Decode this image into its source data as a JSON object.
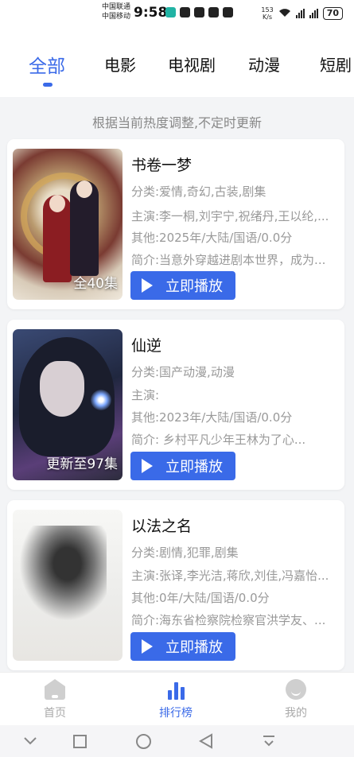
{
  "status_bar": {
    "carrier_1": "中国联通",
    "carrier_2": "中国移动",
    "time": "9:58",
    "net_speed_value": "153",
    "net_speed_unit": "K/s",
    "battery": "70"
  },
  "tabs": [
    {
      "label": "全部"
    },
    {
      "label": "电影"
    },
    {
      "label": "电视剧"
    },
    {
      "label": "动漫"
    },
    {
      "label": "短剧"
    }
  ],
  "hint": "根据当前热度调整,不定时更新",
  "accent_color": "#3a6ae8",
  "cards": [
    {
      "title": "书卷一梦",
      "category": "分类:爱情,奇幻,古装,剧集",
      "cast": "主演:李一桐,刘宇宁,祝绪丹,王以纶,...",
      "other": "其他:2025年/大陆/国语/0.0分",
      "intro": "简介:当意外穿越进剧本世界，成为...",
      "episodes": "全40集",
      "play_label": "立即播放"
    },
    {
      "title": "仙逆",
      "category": "分类:国产动漫,动漫",
      "cast": "主演:",
      "other": "其他:2023年/大陆/国语/0.0分",
      "intro": "简介:       乡村平凡少年王林为了心...",
      "episodes": "更新至97集",
      "play_label": "立即播放"
    },
    {
      "title": "以法之名",
      "category": "分类:剧情,犯罪,剧集",
      "cast": "主演:张译,李光洁,蒋欣,刘佳,冯嘉怡...",
      "other": "其他:0年/大陆/国语/0.0分",
      "intro": "简介:海东省检察院检察官洪学友、...",
      "episodes": "",
      "play_label": "立即播放"
    }
  ],
  "bottom_nav": [
    {
      "label": "首页",
      "icon": "home-icon"
    },
    {
      "label": "排行榜",
      "icon": "ranking-icon"
    },
    {
      "label": "我的",
      "icon": "profile-icon"
    }
  ]
}
